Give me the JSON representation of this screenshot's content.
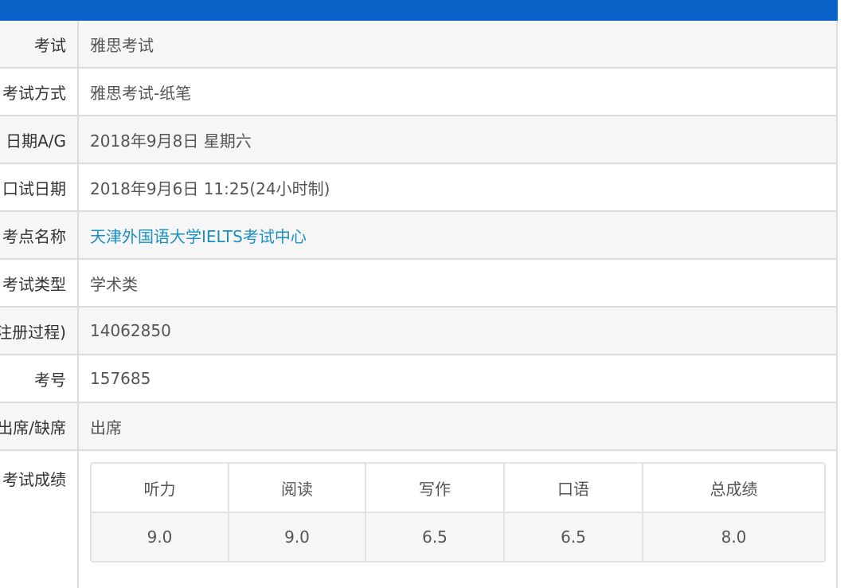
{
  "rows": [
    {
      "label": "考试",
      "value": "雅思考试"
    },
    {
      "label": "考试方式",
      "value": "雅思考试-纸笔"
    },
    {
      "label": "日期A/G",
      "value": "2018年9月8日 星期六"
    },
    {
      "label": "口试日期",
      "value": "2018年9月6日 11:25(24小时制)"
    },
    {
      "label": "考点名称",
      "value": "天津外国语大学IELTS考试中心"
    },
    {
      "label": "考试类型",
      "value": "学术类"
    },
    {
      "label": "注册过程)",
      "value": "14062850"
    },
    {
      "label": "考号",
      "value": "157685"
    },
    {
      "label": "出席/缺席",
      "value": "出席"
    }
  ],
  "scores": {
    "label": "考试成绩",
    "headers": [
      "听力",
      "阅读",
      "写作",
      "口语",
      "总成绩"
    ],
    "values": [
      "9.0",
      "9.0",
      "6.5",
      "6.5",
      "8.0"
    ]
  },
  "colors": {
    "top_bar": "#0a61c8",
    "link": "#1a8fc4"
  }
}
